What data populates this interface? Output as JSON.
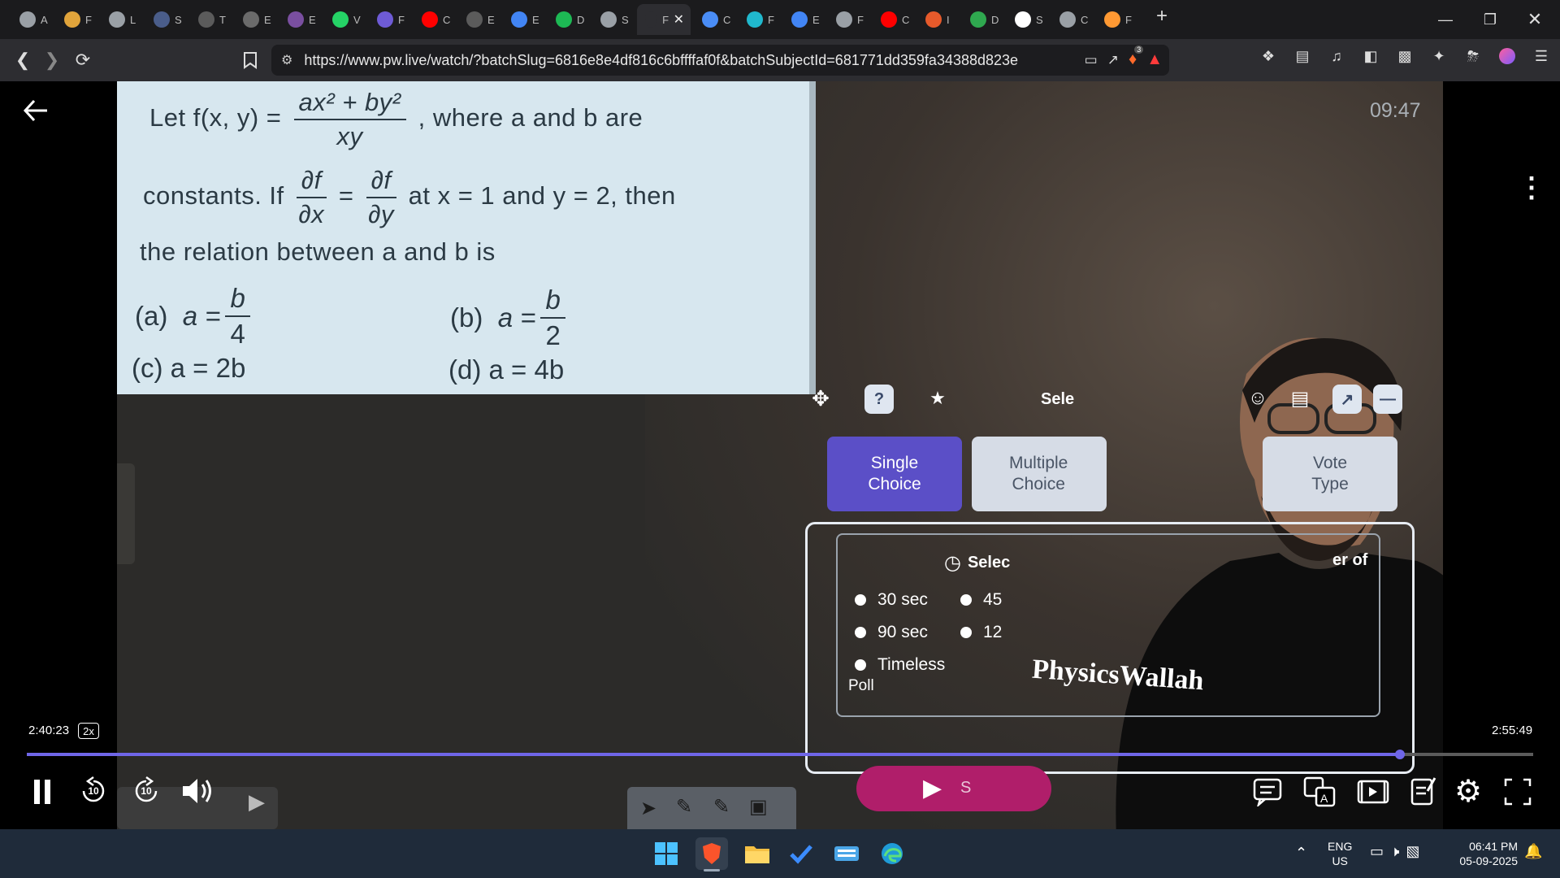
{
  "tabs": [
    {
      "label": "A",
      "icon": "chatgpt-icon",
      "color": "#9aa0a6"
    },
    {
      "label": "F",
      "icon": "spiral-icon",
      "color": "#e1a43b"
    },
    {
      "label": "L",
      "icon": "globe-icon",
      "color": "#9aa0a6"
    },
    {
      "label": "S",
      "icon": "app-icon",
      "color": "#4a5d8a"
    },
    {
      "label": "T",
      "icon": "w-icon",
      "color": "#5b5b5b"
    },
    {
      "label": "E",
      "icon": "doc-icon",
      "color": "#6b6b6b"
    },
    {
      "label": "E",
      "icon": "circle-icon",
      "color": "#7a4fa0"
    },
    {
      "label": "V",
      "icon": "whatsapp-icon",
      "color": "#25d366"
    },
    {
      "label": "F",
      "icon": "bookmark-icon",
      "color": "#6e5bd6"
    },
    {
      "label": "C",
      "icon": "youtube-icon",
      "color": "#ff0000"
    },
    {
      "label": "E",
      "icon": "drip-icon",
      "color": "#5b5b5b"
    },
    {
      "label": "E",
      "icon": "google-icon",
      "color": "#4285f4"
    },
    {
      "label": "D",
      "icon": "spotify-icon",
      "color": "#1db954"
    },
    {
      "label": "S",
      "icon": "globe-icon",
      "color": "#9aa0a6"
    },
    {
      "label": "F",
      "icon": "pw-icon",
      "color": "#2d2d31"
    },
    {
      "label": "C",
      "icon": "gemini-icon",
      "color": "#4a8df6"
    },
    {
      "label": "F",
      "icon": "perplexity-icon",
      "color": "#20b8cd"
    },
    {
      "label": "E",
      "icon": "google-icon",
      "color": "#4285f4"
    },
    {
      "label": "F",
      "icon": "monitor-icon",
      "color": "#9aa0a6"
    },
    {
      "label": "C",
      "icon": "youtube-icon",
      "color": "#ff0000"
    },
    {
      "label": "I",
      "icon": "burger-icon",
      "color": "#e65a2b"
    },
    {
      "label": "D",
      "icon": "chart-icon",
      "color": "#2fa84f"
    },
    {
      "label": "S",
      "icon": "wikipedia-icon",
      "color": "#ffffff"
    },
    {
      "label": "C",
      "icon": "globe-icon",
      "color": "#9aa0a6"
    },
    {
      "label": "F",
      "icon": "india-flag-icon",
      "color": "#ff9933"
    }
  ],
  "active_tab_index": 14,
  "url": "https://www.pw.live/watch/?batchSlug=6816e8e4df816c6bffffaf0f&batchSubjectId=681771dd359fa34388d823e...",
  "brave_badge": "3",
  "slide": {
    "line1_prefix": "Let  f(x, y) =",
    "line1_num": "ax² + by²",
    "line1_den": "xy",
    "line1_suffix": ",  where  a  and  b  are",
    "line2_prefix": "constants. If",
    "dfdx_num": "∂f",
    "dfdx_den": "∂x",
    "equals": "=",
    "dfdy_num": "∂f",
    "dfdy_den": "∂y",
    "line2_suffix": "at x = 1 and y = 2, then",
    "line3": "the relation between a and b is",
    "opt_a_label": "(a)",
    "opt_a_lhs": "a =",
    "opt_a_num": "b",
    "opt_a_den": "4",
    "opt_b_label": "(b)",
    "opt_b_lhs": "a =",
    "opt_b_num": "b",
    "opt_b_den": "2",
    "opt_c": "(c)  a = 2b",
    "opt_d": "(d)  a = 4b"
  },
  "poll": {
    "header_text": "Sele",
    "type_buttons": [
      "Single\nChoice",
      "Multiple\nChoice",
      "Vote\nType"
    ],
    "timer_label": "Selec",
    "count_label": "er of",
    "options": [
      "30 sec",
      "45",
      "90 sec",
      "12",
      "Timeless",
      "Poll"
    ],
    "start_label": "S"
  },
  "watermark": "PhysicsWallah",
  "player": {
    "clock": "09:47",
    "elapsed": "2:40:23",
    "speed": "2x",
    "duration": "2:55:49",
    "progress": 0.9115,
    "rewind_label": "10",
    "forward_label": "10"
  },
  "taskbar": {
    "lang": "ENG",
    "region": "US",
    "time": "06:41 PM",
    "date": "05-09-2025"
  }
}
